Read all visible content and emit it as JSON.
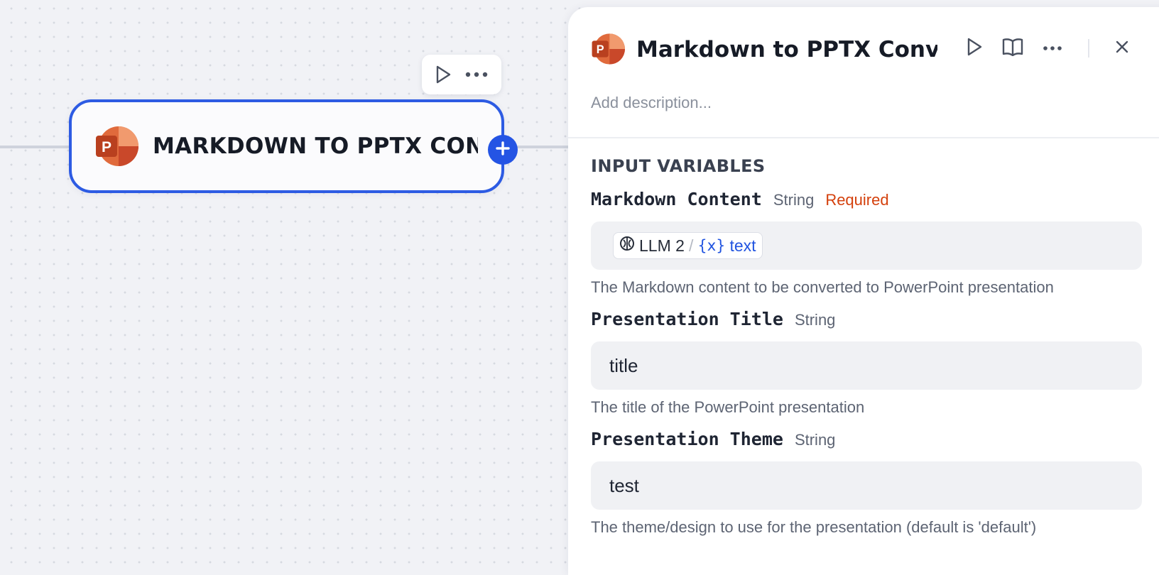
{
  "canvas": {
    "node": {
      "title": "MARKDOWN TO PPTX CONV",
      "icon": "powerpoint-icon"
    },
    "toolbar": {
      "run_icon": "play-icon",
      "more_icon": "more-icon"
    },
    "add_icon": "plus-icon"
  },
  "panel": {
    "title": "Markdown to PPTX Converte",
    "icon": "powerpoint-icon",
    "description_placeholder": "Add description...",
    "header_buttons": [
      "play-icon",
      "book-icon",
      "more-icon",
      "close-icon"
    ],
    "section_title": "INPUT VARIABLES",
    "variables": [
      {
        "name": "Markdown Content",
        "type": "String",
        "required": "Required",
        "value_ref": {
          "node": "LLM 2",
          "separator": "/",
          "var_icon": "{x}",
          "variable": "text"
        },
        "help": "The Markdown content to be converted to PowerPoint presentation"
      },
      {
        "name": "Presentation Title",
        "type": "String",
        "value": "title",
        "help": "The title of the PowerPoint presentation"
      },
      {
        "name": "Presentation Theme",
        "type": "String",
        "value": "test",
        "help": "The theme/design to use for the presentation (default is 'default')"
      }
    ]
  },
  "colors": {
    "accent": "#2454e4",
    "required": "#d4400c",
    "ppt_orange": "#e06a3c",
    "ppt_dark": "#b9401f"
  }
}
